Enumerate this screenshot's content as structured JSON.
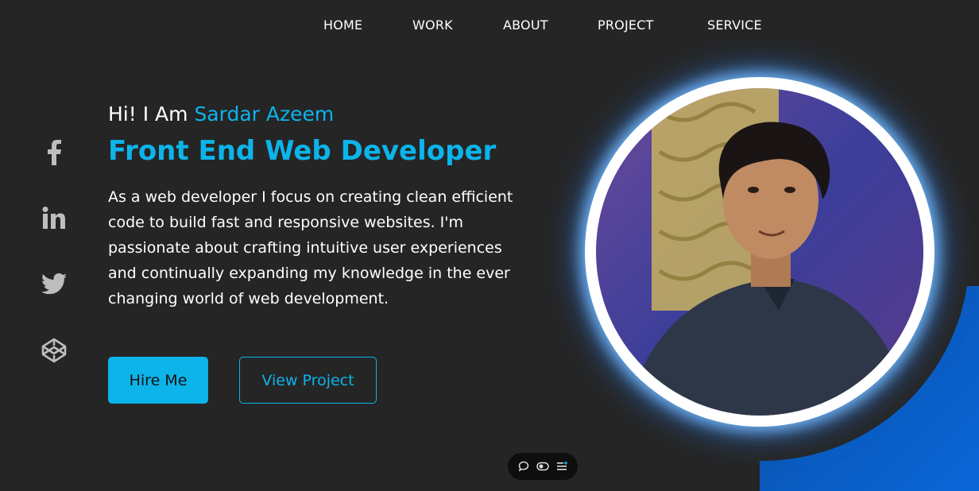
{
  "nav": {
    "items": [
      {
        "label": "HOME"
      },
      {
        "label": "WORK"
      },
      {
        "label": "ABOUT"
      },
      {
        "label": "PROJECT"
      },
      {
        "label": "SERVICE"
      }
    ]
  },
  "hero": {
    "greeting_prefix": "Hi! I Am ",
    "name": "Sardar Azeem",
    "role": "Front End Web Developer",
    "bio": "As a web developer I focus on creating clean efficient code to build fast and responsive websites. I'm passionate about crafting intuitive user experiences and continually expanding my knowledge in the ever changing world of web development."
  },
  "buttons": {
    "hire_label": "Hire Me",
    "view_label": "View Project"
  },
  "social": {
    "icons": [
      "facebook-icon",
      "linkedin-icon",
      "twitter-icon",
      "codepen-icon"
    ]
  },
  "toolbar": {
    "icons": [
      "comment-icon",
      "toggle-icon",
      "menu-icon"
    ]
  },
  "colors": {
    "accent": "#0cb4ea",
    "background": "#252525",
    "blue_block": "#0a5bc0"
  }
}
